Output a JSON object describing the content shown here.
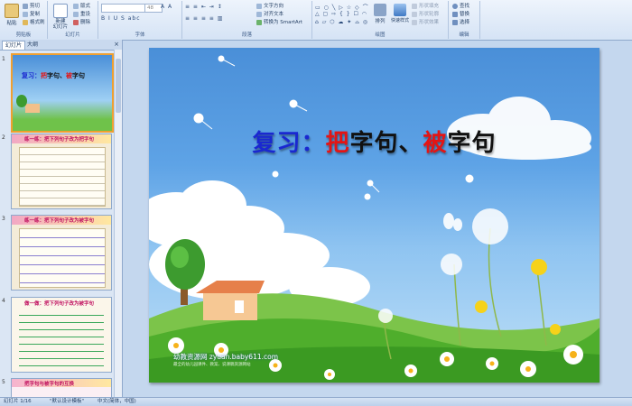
{
  "ribbon": {
    "clipboard": {
      "paste": "粘贴",
      "cut": "剪切",
      "copy": "复制",
      "format_painter": "格式刷",
      "label": "剪贴板"
    },
    "slides": {
      "new_slide": "新建\n幻灯片",
      "layout": "版式",
      "reset": "重设",
      "delete": "删除",
      "label": "幻灯片"
    },
    "font": {
      "font_size": "48",
      "label": "字体"
    },
    "paragraph": {
      "text_direction": "文字方向",
      "align_text": "对齐文本",
      "smartart": "转换为 SmartArt",
      "label": "段落"
    },
    "drawing": {
      "arrange": "排列",
      "quick_styles": "快速样式",
      "shape_fill": "形状填充",
      "shape_outline": "形状轮廓",
      "shape_effects": "形状效果",
      "label": "绘图"
    },
    "editing": {
      "find": "查找",
      "replace": "替换",
      "select": "选择",
      "label": "编辑"
    }
  },
  "panel": {
    "tab_slides": "幻灯片",
    "tab_outline": "大纲",
    "close": "×",
    "thumbs": [
      {
        "num": "1"
      },
      {
        "num": "2",
        "title": "练一练：把下列句子改为把字句"
      },
      {
        "num": "3",
        "title": "练一练：把下列句子改为被字句"
      },
      {
        "num": "4",
        "title": "做一做：把下列句子改为被字句"
      },
      {
        "num": "5",
        "title": "把字句与被字句的互换"
      }
    ]
  },
  "slide": {
    "title_part1": "复习：",
    "title_ba": "把",
    "title_part2": "字句、",
    "title_bei": "被",
    "title_part3": "字句",
    "watermark": "幼教资源网 zyuan.baby611.com",
    "watermark_sub": "最全的幼儿园课件、教案、说课稿资源网站"
  },
  "status": {
    "slide_info": "幻灯片 1/16",
    "theme": "\"默认设计模板\"",
    "language": "中文(简体，中国)"
  },
  "colors": {
    "blue_title": "#1a28d0",
    "red_title": "#e41414",
    "sky": "#4a8fd8",
    "grass": "#4caf2a"
  }
}
